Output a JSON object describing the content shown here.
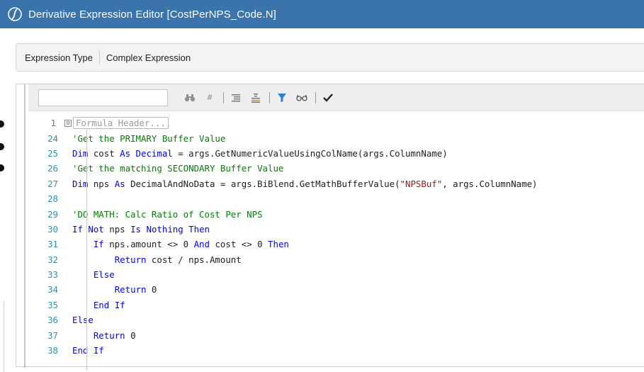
{
  "window": {
    "title": "Derivative Expression Editor  [CostPerNPS_Code.N]",
    "title_bar_color": "#3b73ad"
  },
  "expression": {
    "type_label": "Expression Type",
    "type_value": "Complex Expression"
  },
  "toolbar": {
    "search_value": "",
    "buttons": [
      "binoculars-icon",
      "hash-icon",
      "indent-icon",
      "outdent-icon",
      "filter-icon",
      "glasses-icon",
      "checkmark-icon"
    ]
  },
  "code": {
    "header_line_number": "1",
    "header_collapsed_text": "Formula Header...",
    "lines": [
      {
        "n": "24",
        "segments": [
          {
            "t": "'Get the PRIMARY Buffer Value",
            "c": "cm"
          }
        ]
      },
      {
        "n": "25",
        "segments": [
          {
            "t": "Dim",
            "c": "kw"
          },
          {
            "t": " cost ",
            "c": ""
          },
          {
            "t": "As",
            "c": "kw"
          },
          {
            "t": " ",
            "c": ""
          },
          {
            "t": "Decimal",
            "c": "kw"
          },
          {
            "t": " = args.GetNumericValueUsingColName(args.ColumnName)",
            "c": ""
          }
        ]
      },
      {
        "n": "26",
        "segments": [
          {
            "t": "'Get the matching SECONDARY Buffer Value",
            "c": "cm"
          }
        ]
      },
      {
        "n": "27",
        "segments": [
          {
            "t": "Dim",
            "c": "kw"
          },
          {
            "t": " nps ",
            "c": ""
          },
          {
            "t": "As",
            "c": "kw"
          },
          {
            "t": " DecimalAndNoData = args.BiBlend.GetMathBufferValue(",
            "c": ""
          },
          {
            "t": "\"NPSBuf\"",
            "c": "str"
          },
          {
            "t": ", args.ColumnName)",
            "c": ""
          }
        ]
      },
      {
        "n": "28",
        "segments": [
          {
            "t": "",
            "c": ""
          }
        ]
      },
      {
        "n": "29",
        "segments": [
          {
            "t": "'DO MATH: Calc Ratio of Cost Per NPS",
            "c": "cm"
          }
        ]
      },
      {
        "n": "30",
        "segments": [
          {
            "t": "If",
            "c": "kw"
          },
          {
            "t": " ",
            "c": ""
          },
          {
            "t": "Not",
            "c": "kw"
          },
          {
            "t": " nps ",
            "c": ""
          },
          {
            "t": "Is",
            "c": "kw"
          },
          {
            "t": " ",
            "c": ""
          },
          {
            "t": "Nothing",
            "c": "kw"
          },
          {
            "t": " ",
            "c": ""
          },
          {
            "t": "Then",
            "c": "kw"
          }
        ]
      },
      {
        "n": "31",
        "segments": [
          {
            "t": "    ",
            "c": ""
          },
          {
            "t": "If",
            "c": "kw"
          },
          {
            "t": " nps.amount <> 0 ",
            "c": ""
          },
          {
            "t": "And",
            "c": "kw"
          },
          {
            "t": " cost <> 0 ",
            "c": ""
          },
          {
            "t": "Then",
            "c": "kw"
          }
        ]
      },
      {
        "n": "32",
        "segments": [
          {
            "t": "        ",
            "c": ""
          },
          {
            "t": "Return",
            "c": "kw"
          },
          {
            "t": " cost / nps.Amount",
            "c": ""
          }
        ]
      },
      {
        "n": "33",
        "segments": [
          {
            "t": "    ",
            "c": ""
          },
          {
            "t": "Else",
            "c": "kw"
          }
        ]
      },
      {
        "n": "34",
        "segments": [
          {
            "t": "        ",
            "c": ""
          },
          {
            "t": "Return",
            "c": "kw"
          },
          {
            "t": " 0",
            "c": ""
          }
        ]
      },
      {
        "n": "35",
        "segments": [
          {
            "t": "    ",
            "c": ""
          },
          {
            "t": "End",
            "c": "kw"
          },
          {
            "t": " ",
            "c": ""
          },
          {
            "t": "If",
            "c": "kw"
          }
        ]
      },
      {
        "n": "36",
        "segments": [
          {
            "t": "Else",
            "c": "kw"
          }
        ]
      },
      {
        "n": "37",
        "segments": [
          {
            "t": "    ",
            "c": ""
          },
          {
            "t": "Return",
            "c": "kw"
          },
          {
            "t": " 0",
            "c": ""
          }
        ]
      },
      {
        "n": "38",
        "segments": [
          {
            "t": "End",
            "c": "kw"
          },
          {
            "t": " ",
            "c": ""
          },
          {
            "t": "If",
            "c": "kw"
          }
        ]
      }
    ]
  },
  "colors": {
    "keyword": "#0000ff",
    "comment": "#008000",
    "string": "#a31515",
    "line_number": "#2b91af"
  }
}
